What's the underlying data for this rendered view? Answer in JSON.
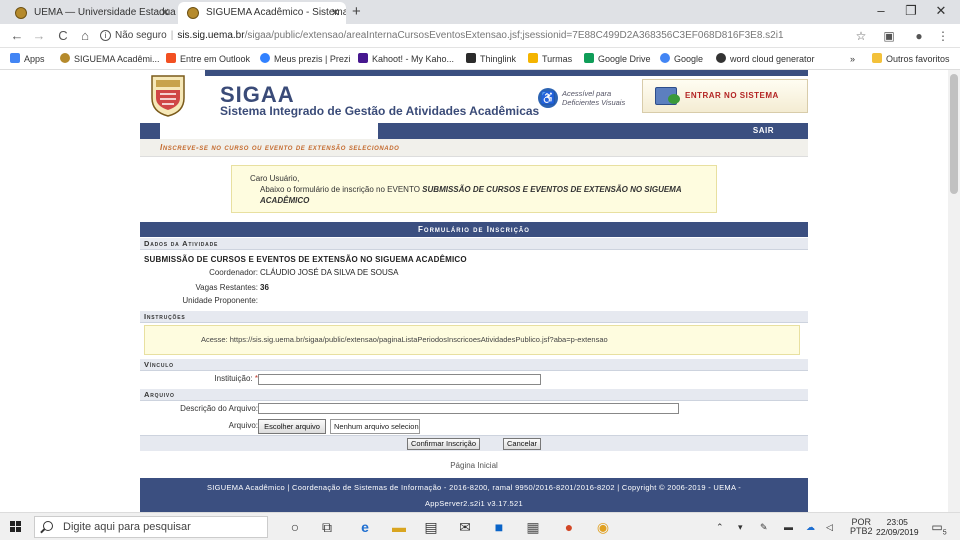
{
  "browser": {
    "tabs": [
      {
        "title": "UEMA — Universidade Estadual d",
        "active": false
      },
      {
        "title": "SIGUEMA Acadêmico - Sistema In",
        "active": true
      }
    ],
    "window_controls": {
      "minimize": "–",
      "maximize": "❐",
      "close": "✕"
    },
    "nav": {
      "back": "←",
      "forward": "→",
      "reload": "C",
      "home": "⌂"
    },
    "address": {
      "security": "Não seguro",
      "host": "sis.sig.uema.br",
      "path": "/sigaa/public/extensao/areaInternaCursosEventosExtensao.jsf;jsessionid=7E88C499D2A368356C3EF068D816F3E8.s2i1"
    },
    "bookmarks": [
      {
        "label": "Apps",
        "icon": "apps-icon",
        "color": "#4285f4"
      },
      {
        "label": "SIGUEMA Acadêmi...",
        "icon": "siguema-icon",
        "color": "#b58a2c"
      },
      {
        "label": "Entre em Outlook",
        "icon": "windows-icon",
        "color": "#f25022"
      },
      {
        "label": "Meus prezis | Prezi",
        "icon": "prezi-icon",
        "color": "#3181ff"
      },
      {
        "label": "Kahoot! - My Kaho...",
        "icon": "kahoot-icon",
        "color": "#46178f"
      },
      {
        "label": "Thinglink",
        "icon": "thinglink-icon",
        "color": "#2b2b2b"
      },
      {
        "label": "Turmas",
        "icon": "classroom-icon",
        "color": "#f4b400"
      },
      {
        "label": "Google Drive",
        "icon": "drive-icon",
        "color": "#0f9d58"
      },
      {
        "label": "Google",
        "icon": "google-icon",
        "color": "#4285f4"
      },
      {
        "label": "word cloud generator",
        "icon": "cloud-icon",
        "color": "#333333"
      },
      {
        "label": "»",
        "icon": "more-icon",
        "color": "#ffffff"
      },
      {
        "label": "Outros favoritos",
        "icon": "folder-icon",
        "color": "#f3c13a"
      }
    ]
  },
  "header": {
    "brand": "SIGAA",
    "subtitle": "Sistema Integrado de Gestão de Atividades Acadêmicas",
    "accessibility": "Acessível para Deficientes Visuais",
    "login_label": "ENTRAR NO SISTEMA",
    "logout_label": "SAIR"
  },
  "breadcrumb": "Inscreve-se no curso ou evento de extensão selecionado",
  "notice": {
    "greeting": "Caro Usuário,",
    "text": "Abaixo o formulário de inscrição no EVENTO",
    "event": "SUBMISSÃO DE CURSOS E EVENTOS DE EXTENSÃO NO SIGUEMA ACADÊMICO"
  },
  "form": {
    "title": "Formulário de Inscrição",
    "activity_section": "Dados da Atividade",
    "activity_title": "SUBMISSÃO DE CURSOS E EVENTOS DE EXTENSÃO NO SIGUEMA ACADÊMICO",
    "coordinator_label": "Coordenador:",
    "coordinator_value": "CLÁUDIO JOSÉ DA SILVA DE SOUSA",
    "vacancies_label": "Vagas Restantes:",
    "vacancies_value": "36",
    "unit_label": "Unidade Proponente:",
    "unit_value": "",
    "instructions_section": "Instruções",
    "instructions_text": "Acesse: https://sis.sig.uema.br/sigaa/public/extensao/paginaListaPeriodosInscricoesAtividadesPublico.jsf?aba=p-extensao",
    "link_section": "Vínculo",
    "institution_label": "Instituição:",
    "institution_required": "*",
    "institution_value": "",
    "file_section": "Arquivo",
    "file_desc_label": "Descrição do Arquivo:",
    "file_desc_value": "",
    "file_label": "Arquivo:",
    "file_button": "Escolher arquivo",
    "file_none": "Nenhum arquivo selecionado",
    "confirm": "Confirmar Inscrição",
    "cancel": "Cancelar"
  },
  "home_link": "Página Inicial",
  "footer": {
    "line1": "SIGUEMA Acadêmico | Coordenação de Sistemas de Informação - 2016-8200, ramal 9950/2016-8201/2016-8202 | Copyright © 2006-2019 - UEMA -",
    "line2": "AppServer2.s2i1 v3.17.521"
  },
  "taskbar": {
    "search_placeholder": "Digite aqui para pesquisar",
    "apps": [
      "cortana-icon",
      "task-view-icon",
      "edge-icon",
      "explorer-icon",
      "store-icon",
      "mail-icon",
      "outlook-icon",
      "remote-icon",
      "powerpoint-icon",
      "chrome-icon"
    ],
    "lang": "POR",
    "layout": "PTB2",
    "time": "23:05",
    "date": "22/09/2019",
    "notification_count": "5"
  }
}
